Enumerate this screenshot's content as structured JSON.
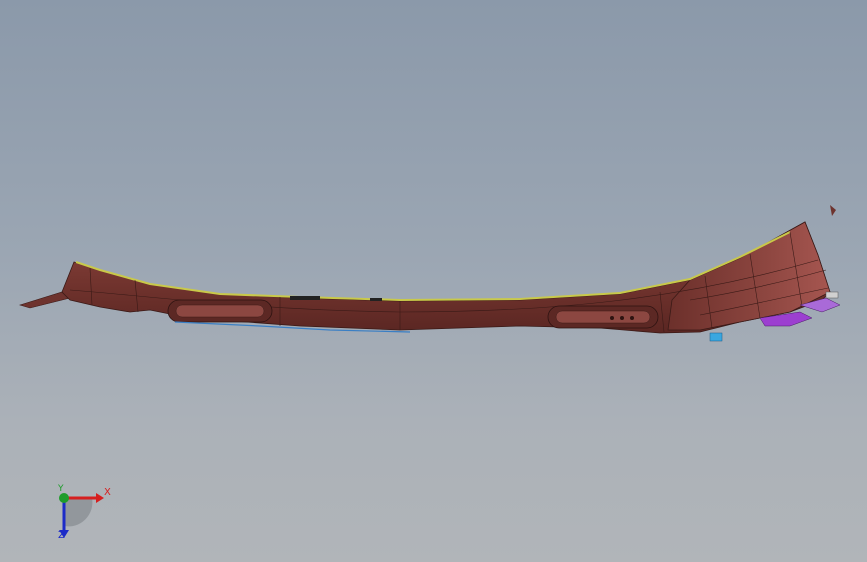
{
  "viewport": {
    "background_top": "#8b99aa",
    "background_bottom": "#b1b5b9"
  },
  "model": {
    "part_color": "#7a3a35",
    "highlight_color": "#c8c84a",
    "accent_blue": "#2e8fd6",
    "accent_purple": "#9c3fd0"
  },
  "triad": {
    "x_label": "X",
    "y_label": "Y",
    "z_label": "Z",
    "x_color": "#d61f1f",
    "y_color": "#1e9c2a",
    "z_color": "#1c2bc8"
  }
}
